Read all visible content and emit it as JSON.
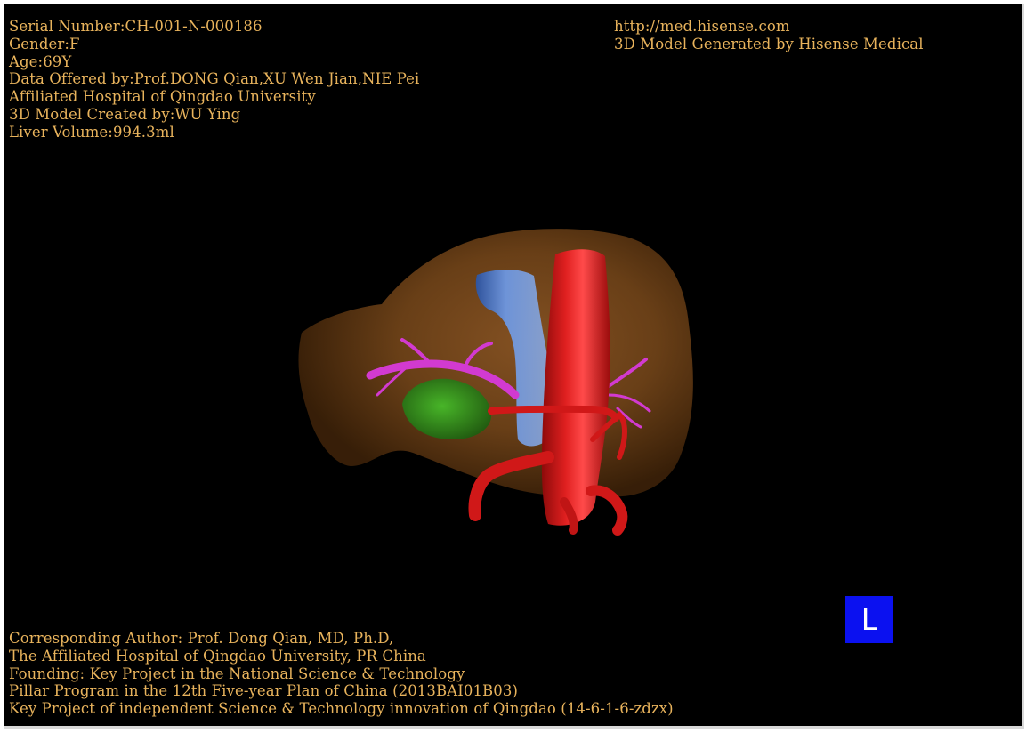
{
  "colors": {
    "background": "#000000",
    "text": "#e8b35c",
    "liver": "#7a4a1c",
    "aorta": "#d01818",
    "vena_cava": "#4a7fd4",
    "portal_vein": "#d23ad0",
    "gallbladder": "#2f9a1c",
    "orientation_marker": "#0b11f0"
  },
  "header_left": {
    "serial_number": "Serial Number:CH-001-N-000186",
    "gender": "Gender:F",
    "age": "Age:69Y",
    "data_offered_by": "Data Offered by:Prof.DONG Qian,XU Wen Jian,NIE Pei",
    "hospital": "Affiliated Hospital of Qingdao University",
    "model_created_by": "3D Model Created by:WU Ying",
    "liver_volume": "Liver Volume:994.3ml"
  },
  "header_right": {
    "url": "http://med.hisense.com",
    "generator": "3D Model Generated by Hisense Medical"
  },
  "footer": {
    "line1": "Corresponding Author: Prof. Dong Qian, MD, Ph.D,",
    "line2": "The Affiliated Hospital of Qingdao University, PR China",
    "line3": "Founding: Key Project in the National Science & Technology",
    "line4": "Pillar Program in the 12th Five-year Plan of China (2013BAI01B03)",
    "line5": "Key Project of independent Science & Technology innovation of Qingdao (14-6-1-6-zdzx)"
  },
  "orientation_marker": {
    "label": "L"
  }
}
